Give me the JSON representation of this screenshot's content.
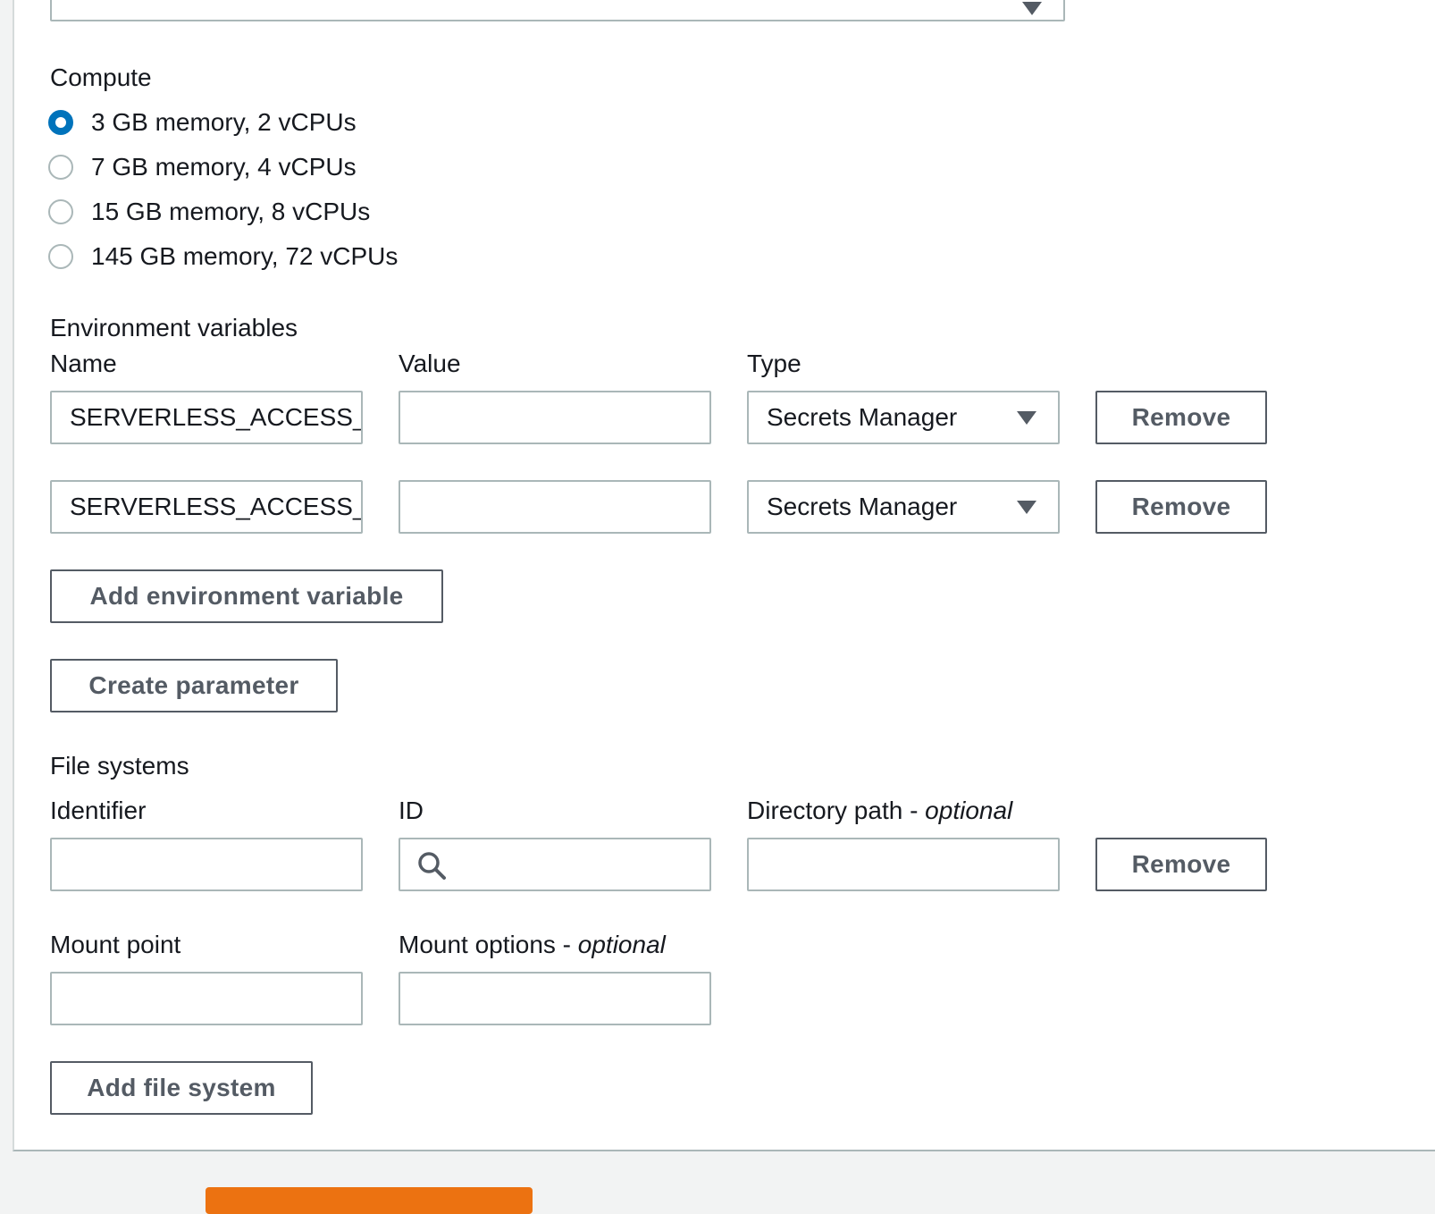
{
  "compute": {
    "label": "Compute",
    "options": [
      {
        "label": "3 GB memory, 2 vCPUs",
        "selected": true
      },
      {
        "label": "7 GB memory, 4 vCPUs",
        "selected": false
      },
      {
        "label": "15 GB memory, 8 vCPUs",
        "selected": false
      },
      {
        "label": "145 GB memory, 72 vCPUs",
        "selected": false
      }
    ]
  },
  "env": {
    "section_label": "Environment variables",
    "col_name": "Name",
    "col_value": "Value",
    "col_type": "Type",
    "rows": [
      {
        "name": "SERVERLESS_ACCESS_K",
        "value": "",
        "type": "Secrets Manager",
        "remove_label": "Remove"
      },
      {
        "name": "SERVERLESS_ACCESS_K",
        "value": "",
        "type": "Secrets Manager",
        "remove_label": "Remove"
      }
    ],
    "add_label": "Add environment variable",
    "create_param_label": "Create parameter"
  },
  "fs": {
    "section_label": "File systems",
    "col_identifier": "Identifier",
    "col_id": "ID",
    "col_dir": "Directory path - ",
    "col_dir_opt": "optional",
    "remove_label": "Remove",
    "col_mount_point": "Mount point",
    "col_mount_options": "Mount options - ",
    "col_mount_options_opt": "optional",
    "add_label": "Add file system"
  },
  "colors": {
    "accent": "#0073bb",
    "primary_button": "#ec7211",
    "border": "#aab7b8",
    "button_text": "#545b64"
  }
}
